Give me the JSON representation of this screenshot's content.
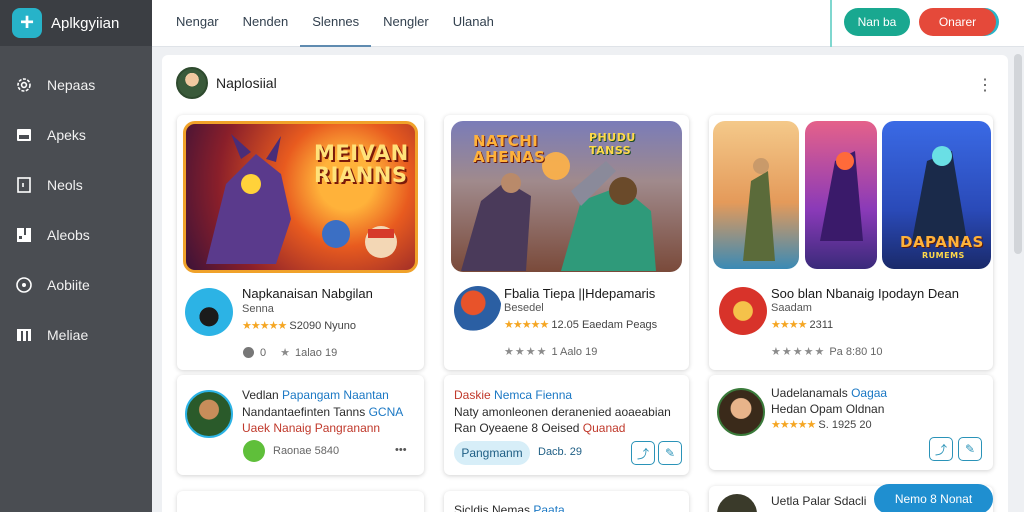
{
  "app": {
    "logo_glyph": "+",
    "name": "Aplkgyiian"
  },
  "sidebar": {
    "items": [
      {
        "label": "Nepaas",
        "icon": "gear-icon"
      },
      {
        "label": "Apeks",
        "icon": "store-icon"
      },
      {
        "label": "Neols",
        "icon": "document-icon"
      },
      {
        "label": "Aleobs",
        "icon": "puzzle-icon"
      },
      {
        "label": "Aobiite",
        "icon": "info-icon"
      },
      {
        "label": "Meliae",
        "icon": "library-icon"
      }
    ]
  },
  "topbar": {
    "tabs": [
      "Nengar",
      "Nenden",
      "Slennes",
      "Nengler",
      "Ulanah"
    ],
    "active_tab": 2,
    "primary_button": "Nan ba",
    "secondary_button": "Onarer"
  },
  "panel": {
    "title": "Naplosiial",
    "more_label": "⋮"
  },
  "cards": [
    {
      "art_title": "MEIVAN RIANNS",
      "title": "Napkanaisan Nabgilan",
      "dev": "Senna",
      "rating_stars": "★★★★★",
      "rating_text": "S2090 Nyuno",
      "meta_left": "0",
      "meta_right": "1alao 19"
    },
    {
      "art_title": "NATCHI AHENAS",
      "art_subtitle": "PHUDU TANSS",
      "title": "Fbalia Tiepa ||Hdepamaris",
      "dev": "Besedel",
      "rating_stars": "★★★★★",
      "rating_text": "12.05 Eaedam Peags",
      "meta_right": "1 Aalo 19"
    },
    {
      "art_title": "DAPANAS",
      "art_subtitle": "RUMEMS",
      "title": "Soo blan Nbanaig Ipodayn Dean",
      "dev": "Saadam",
      "rating_stars": "★★★★",
      "rating_text": "2311",
      "meta_right": "Pa 8:80 10"
    }
  ],
  "row2": [
    {
      "line1_prefix": "Vedlan",
      "line1_blue": "Papangam Naantan",
      "line2": "Nandantaefinten Tanns",
      "line2_blue": "GCNA",
      "line3": "Uaek Nanaig Pangranann",
      "meta": "Raonae 5840",
      "more": "•••"
    },
    {
      "line1_red": "Daskie",
      "line1_blue": "Nemca Fienna",
      "line2": "Naty amonleonen deranenied aoaeabian",
      "line3_prefix": "Ran Oyeaene 8",
      "line3_suffix": "Oeised",
      "line3_red": "Quanad",
      "chip": "Pangmanm",
      "date": "Dacb. 29"
    },
    {
      "line1": "Uadelanamals",
      "line1_blue": "Oagaa",
      "line2": "Hedan Opam Oldnan",
      "rating_stars": "★★★★★",
      "rating_text": "S. 1925 20"
    }
  ],
  "row3": [
    {
      "text": ""
    },
    {
      "text": "Sicldis Nemas",
      "text_blue": "Paata"
    },
    {
      "text": "Uetla Palar Sdacli"
    }
  ],
  "fab": {
    "label": "Nemo 8 Nonat"
  }
}
